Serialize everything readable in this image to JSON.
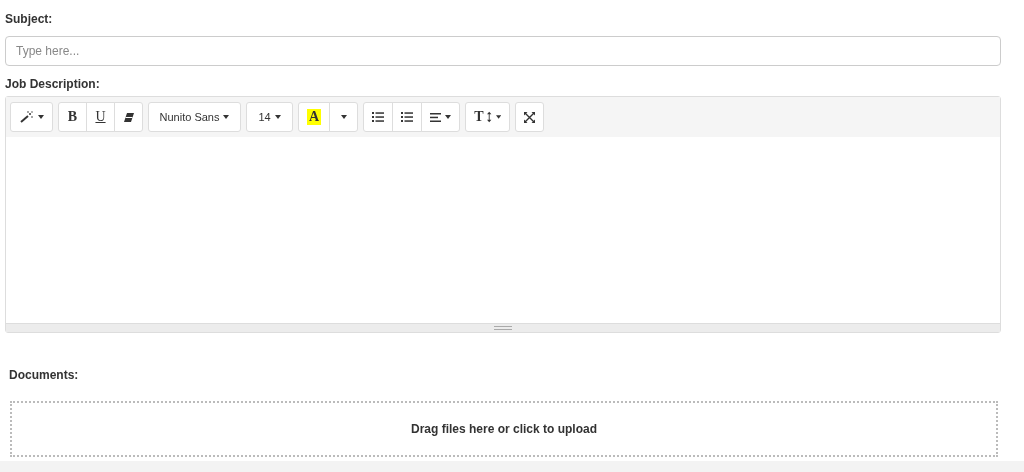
{
  "subject": {
    "label": "Subject:",
    "placeholder": "Type here..."
  },
  "description": {
    "label": "Job Description:",
    "toolbar": [
      [
        {
          "kind": "magic"
        }
      ],
      [
        {
          "kind": "bold",
          "label": "B"
        },
        {
          "kind": "underline",
          "label": "U"
        },
        {
          "kind": "eraser"
        }
      ],
      [
        {
          "kind": "font",
          "label": "Nunito Sans"
        }
      ],
      [
        {
          "kind": "size",
          "label": "14"
        }
      ],
      [
        {
          "kind": "color",
          "label": "A"
        },
        {
          "kind": "caret"
        }
      ],
      [
        {
          "kind": "ul"
        },
        {
          "kind": "ol"
        },
        {
          "kind": "align"
        }
      ],
      [
        {
          "kind": "textheight",
          "label": "T"
        }
      ],
      [
        {
          "kind": "fullscreen"
        }
      ]
    ]
  },
  "documents": {
    "label": "Documents:",
    "dropzone": "Drag files here or click to upload"
  }
}
